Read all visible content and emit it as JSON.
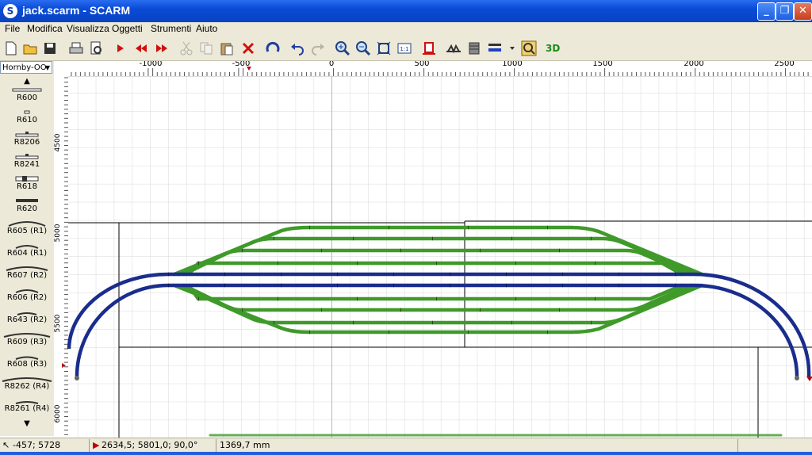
{
  "window": {
    "title": "jack.scarm - SCARM",
    "app_icon": "S"
  },
  "menu": [
    "File",
    "Modifica",
    "Visualizza",
    "Oggetti",
    "Strumenti",
    "Aiuto"
  ],
  "toolbar": {
    "icons": [
      "new-icon",
      "open-icon",
      "save-icon",
      "print-icon",
      "print-preview-icon",
      "select-icon",
      "prev-icon",
      "next-icon",
      "cut-icon",
      "copy-icon",
      "paste-icon",
      "delete-icon",
      "rotate-icon",
      "undo-icon",
      "redo-icon",
      "zoom-in-icon",
      "zoom-out-icon",
      "zoom-fit-icon",
      "zoom-1to1-icon",
      "flex-track-icon",
      "bridge-icon",
      "tunnel-icon",
      "layer-icon",
      "measure-icon"
    ],
    "three_d_label": "3D"
  },
  "library": {
    "selected": "Hornby-OO",
    "items": [
      "R600",
      "R610",
      "R8206",
      "R8241",
      "R618",
      "R620",
      "R605 (R1)",
      "R604 (R1)",
      "R607 (R2)",
      "R606 (R2)",
      "R643 (R2)",
      "R609 (R3)",
      "R608 (R3)",
      "R8262 (R4)",
      "R8261 (R4)"
    ]
  },
  "ruler": {
    "unit": "mm",
    "x_labels": [
      "-1000",
      "-500",
      "0",
      "500",
      "1000",
      "1500",
      "2000",
      "2500"
    ],
    "y_labels": [
      "4500",
      "5000",
      "5500",
      "6000"
    ]
  },
  "status": {
    "cursor": "-457; 5728",
    "position": "2634,5; 5801,0; 90,0°",
    "length": "1369,7 mm"
  },
  "colors": {
    "main_track": "#1a2d8c",
    "siding_track": "#3f9a2a",
    "titlebar": "#0a4bd6",
    "panel": "#ece9d8"
  }
}
